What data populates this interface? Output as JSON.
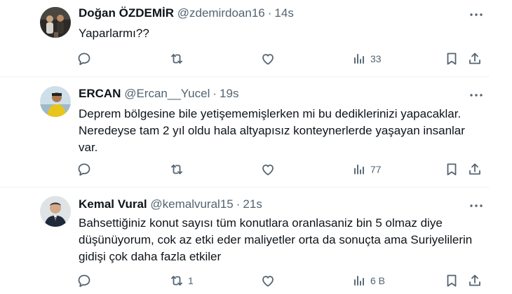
{
  "tweets": [
    {
      "name": "Doğan ÖZDEMİR",
      "handle": "@zdemirdoan16",
      "separator": "·",
      "time": "14s",
      "lines": [
        "Yaparlarmı??"
      ],
      "reply_count": "",
      "retweet_count": "",
      "like_count": "",
      "views": "33"
    },
    {
      "name": "ERCAN",
      "handle": "@Ercan__Yucel",
      "separator": "·",
      "time": "19s",
      "lines": [
        "Deprem bölgesine bile yetişememişlerken mi bu dediklerinizi yapacaklar.",
        "Neredeyse tam 2 yıl oldu hala altyapısız konteynerlerde yaşayan insanlar",
        "var."
      ],
      "reply_count": "",
      "retweet_count": "",
      "like_count": "",
      "views": "77"
    },
    {
      "name": "Kemal Vural",
      "handle": "@kemalvural15",
      "separator": "·",
      "time": "21s",
      "lines": [
        "Bahsettiğiniz konut sayısı tüm konutlara oranlasaniz bin 5 olmaz diye",
        "düşünüyorum, cok az etki eder maliyetler orta da sonuçta ama Suriyelilerin",
        "gidişi çok daha fazla etkiler"
      ],
      "reply_count": "",
      "retweet_count": "1",
      "like_count": "",
      "views": "6 B"
    }
  ],
  "icons": {
    "reply": "reply-icon",
    "retweet": "retweet-icon",
    "like": "heart-icon",
    "views": "views-chart-icon",
    "bookmark": "bookmark-icon",
    "share": "share-icon",
    "more": "more-dots-icon"
  },
  "colors": {
    "text": "#0f1419",
    "secondary": "#536471",
    "divider": "#eff3f4"
  }
}
